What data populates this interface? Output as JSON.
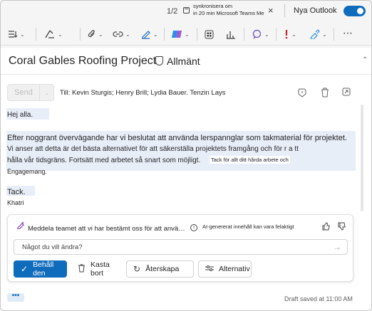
{
  "topbar": {
    "counter": "1/2",
    "reminder_line1": "synkronisera om",
    "reminder_line2": "in 20 min Microsoft Teams Mee...",
    "new_outlook_label": "Nya Outlook",
    "new_outlook_on": true
  },
  "ribbon": {
    "icons": [
      "format-list-icon",
      "format-painter-icon",
      "attach-icon",
      "link-icon",
      "signature-icon",
      "copilot-icon",
      "apps-icon",
      "insights-icon",
      "loop-icon",
      "importance-icon",
      "sensitivity-icon",
      "more-icon"
    ]
  },
  "message": {
    "subject": "Coral Gables Roofing Project",
    "sensitivity": "Allmänt",
    "send_label": "Send",
    "to_line": "Till: Kevin Sturgis; Henry Brill; Lydia Bauer. Tenzin Lays",
    "greeting": "Hej alla.",
    "p1": "Efter noggrant övervägande har vi beslutat att använda lerspannglar som takmaterial för projektet.",
    "p2": "Vi anser att detta är det bästa alternativet för att säkerställa projektets framgång och för r a tt",
    "p3": "hålla vår tidsgräns. Fortsätt med arbetet så snart som möjligt.",
    "p4": "Engagemang.",
    "tooltip": "Tack för allt ditt hårda arbete och",
    "signoff": "Tack.",
    "signature": "Khatri"
  },
  "copilot": {
    "prompt": "Meddela teamet att vi har bestämt oss för att använda...",
    "disclaimer": "AI-genererat innehåll kan vara felaktigt",
    "ask_placeholder": "Något du vill ändra?",
    "keep_label": "Behåll den",
    "discard_label": "Kasta bort",
    "regenerate_label": "Återskapa",
    "options_label": "Alternativ"
  },
  "footer": {
    "more": "•••",
    "draft_status": "Draft saved at 11:00 AM"
  },
  "colors": {
    "accent": "#0f6cbd",
    "copilot": "#7b3fb5"
  }
}
